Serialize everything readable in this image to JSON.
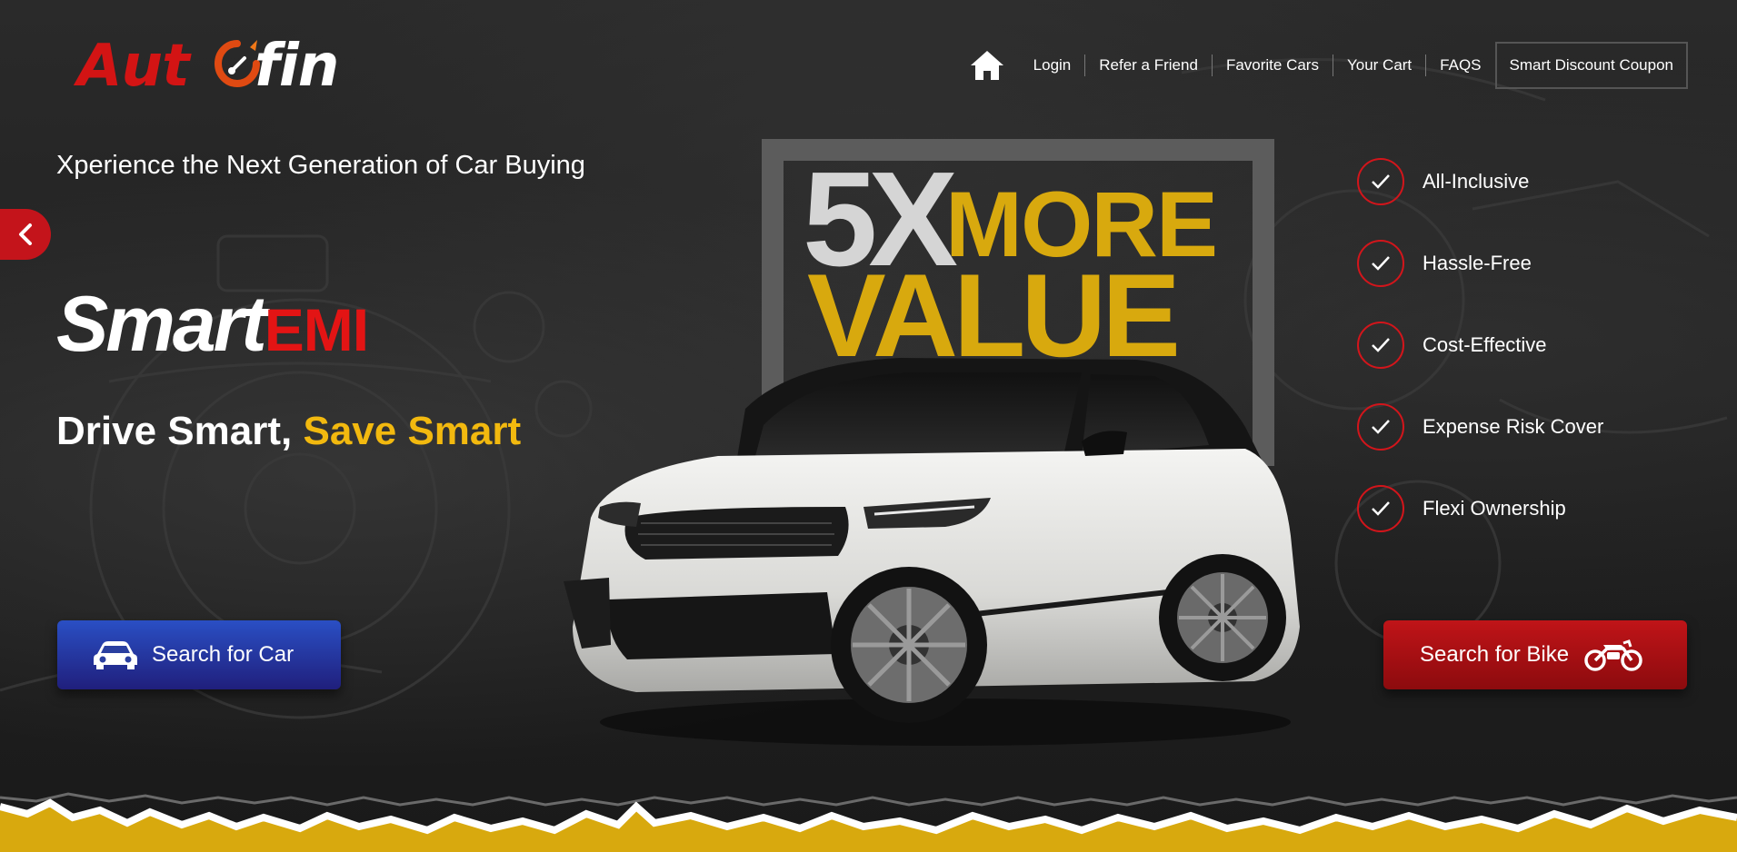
{
  "logo": {
    "part1": "Aut",
    "part2": "fin",
    "icon": "speedometer-icon"
  },
  "nav": {
    "home_icon": "home-icon",
    "items": [
      "Login",
      "Refer a Friend",
      "Favorite Cars",
      "Your Cart",
      "FAQS"
    ],
    "coupon": "Smart Discount Coupon"
  },
  "slider": {
    "prev_icon": "chevron-left-icon"
  },
  "hero": {
    "tagline": "Xperience the Next Generation of Car Buying",
    "brand_part1": "Smart",
    "brand_part2": "EMI",
    "slogan_part1": "Drive Smart, ",
    "slogan_part2": "Save Smart"
  },
  "promo": {
    "multiplier": "5X",
    "word1": "MORE",
    "word2": "VALUE"
  },
  "features": [
    {
      "label": "All-Inclusive",
      "icon": "check-icon"
    },
    {
      "label": "Hassle-Free",
      "icon": "check-icon"
    },
    {
      "label": "Cost-Effective",
      "icon": "check-icon"
    },
    {
      "label": "Expense Risk Cover",
      "icon": "check-icon"
    },
    {
      "label": "Flexi Ownership",
      "icon": "check-icon"
    }
  ],
  "cta": {
    "car_label": "Search for Car",
    "car_icon": "car-icon",
    "bike_label": "Search for Bike",
    "bike_icon": "motorbike-icon"
  },
  "colors": {
    "brand_red": "#d31414",
    "accent_yellow": "#f2b90f",
    "promo_gold": "#d8a90e",
    "car_button_blue": "#2a4fc4",
    "bike_button_red": "#c01418",
    "background": "#222222"
  }
}
